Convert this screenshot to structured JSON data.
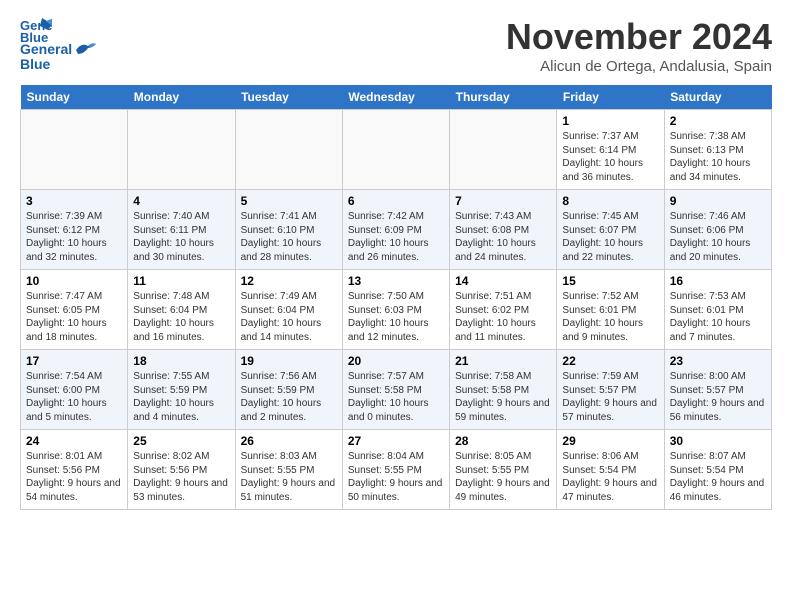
{
  "header": {
    "logo_line1": "General",
    "logo_line2": "Blue",
    "month_title": "November 2024",
    "location": "Alicun de Ortega, Andalusia, Spain"
  },
  "days_of_week": [
    "Sunday",
    "Monday",
    "Tuesday",
    "Wednesday",
    "Thursday",
    "Friday",
    "Saturday"
  ],
  "weeks": [
    [
      {
        "day": "",
        "info": ""
      },
      {
        "day": "",
        "info": ""
      },
      {
        "day": "",
        "info": ""
      },
      {
        "day": "",
        "info": ""
      },
      {
        "day": "",
        "info": ""
      },
      {
        "day": "1",
        "info": "Sunrise: 7:37 AM\nSunset: 6:14 PM\nDaylight: 10 hours and 36 minutes."
      },
      {
        "day": "2",
        "info": "Sunrise: 7:38 AM\nSunset: 6:13 PM\nDaylight: 10 hours and 34 minutes."
      }
    ],
    [
      {
        "day": "3",
        "info": "Sunrise: 7:39 AM\nSunset: 6:12 PM\nDaylight: 10 hours and 32 minutes."
      },
      {
        "day": "4",
        "info": "Sunrise: 7:40 AM\nSunset: 6:11 PM\nDaylight: 10 hours and 30 minutes."
      },
      {
        "day": "5",
        "info": "Sunrise: 7:41 AM\nSunset: 6:10 PM\nDaylight: 10 hours and 28 minutes."
      },
      {
        "day": "6",
        "info": "Sunrise: 7:42 AM\nSunset: 6:09 PM\nDaylight: 10 hours and 26 minutes."
      },
      {
        "day": "7",
        "info": "Sunrise: 7:43 AM\nSunset: 6:08 PM\nDaylight: 10 hours and 24 minutes."
      },
      {
        "day": "8",
        "info": "Sunrise: 7:45 AM\nSunset: 6:07 PM\nDaylight: 10 hours and 22 minutes."
      },
      {
        "day": "9",
        "info": "Sunrise: 7:46 AM\nSunset: 6:06 PM\nDaylight: 10 hours and 20 minutes."
      }
    ],
    [
      {
        "day": "10",
        "info": "Sunrise: 7:47 AM\nSunset: 6:05 PM\nDaylight: 10 hours and 18 minutes."
      },
      {
        "day": "11",
        "info": "Sunrise: 7:48 AM\nSunset: 6:04 PM\nDaylight: 10 hours and 16 minutes."
      },
      {
        "day": "12",
        "info": "Sunrise: 7:49 AM\nSunset: 6:04 PM\nDaylight: 10 hours and 14 minutes."
      },
      {
        "day": "13",
        "info": "Sunrise: 7:50 AM\nSunset: 6:03 PM\nDaylight: 10 hours and 12 minutes."
      },
      {
        "day": "14",
        "info": "Sunrise: 7:51 AM\nSunset: 6:02 PM\nDaylight: 10 hours and 11 minutes."
      },
      {
        "day": "15",
        "info": "Sunrise: 7:52 AM\nSunset: 6:01 PM\nDaylight: 10 hours and 9 minutes."
      },
      {
        "day": "16",
        "info": "Sunrise: 7:53 AM\nSunset: 6:01 PM\nDaylight: 10 hours and 7 minutes."
      }
    ],
    [
      {
        "day": "17",
        "info": "Sunrise: 7:54 AM\nSunset: 6:00 PM\nDaylight: 10 hours and 5 minutes."
      },
      {
        "day": "18",
        "info": "Sunrise: 7:55 AM\nSunset: 5:59 PM\nDaylight: 10 hours and 4 minutes."
      },
      {
        "day": "19",
        "info": "Sunrise: 7:56 AM\nSunset: 5:59 PM\nDaylight: 10 hours and 2 minutes."
      },
      {
        "day": "20",
        "info": "Sunrise: 7:57 AM\nSunset: 5:58 PM\nDaylight: 10 hours and 0 minutes."
      },
      {
        "day": "21",
        "info": "Sunrise: 7:58 AM\nSunset: 5:58 PM\nDaylight: 9 hours and 59 minutes."
      },
      {
        "day": "22",
        "info": "Sunrise: 7:59 AM\nSunset: 5:57 PM\nDaylight: 9 hours and 57 minutes."
      },
      {
        "day": "23",
        "info": "Sunrise: 8:00 AM\nSunset: 5:57 PM\nDaylight: 9 hours and 56 minutes."
      }
    ],
    [
      {
        "day": "24",
        "info": "Sunrise: 8:01 AM\nSunset: 5:56 PM\nDaylight: 9 hours and 54 minutes."
      },
      {
        "day": "25",
        "info": "Sunrise: 8:02 AM\nSunset: 5:56 PM\nDaylight: 9 hours and 53 minutes."
      },
      {
        "day": "26",
        "info": "Sunrise: 8:03 AM\nSunset: 5:55 PM\nDaylight: 9 hours and 51 minutes."
      },
      {
        "day": "27",
        "info": "Sunrise: 8:04 AM\nSunset: 5:55 PM\nDaylight: 9 hours and 50 minutes."
      },
      {
        "day": "28",
        "info": "Sunrise: 8:05 AM\nSunset: 5:55 PM\nDaylight: 9 hours and 49 minutes."
      },
      {
        "day": "29",
        "info": "Sunrise: 8:06 AM\nSunset: 5:54 PM\nDaylight: 9 hours and 47 minutes."
      },
      {
        "day": "30",
        "info": "Sunrise: 8:07 AM\nSunset: 5:54 PM\nDaylight: 9 hours and 46 minutes."
      }
    ]
  ]
}
